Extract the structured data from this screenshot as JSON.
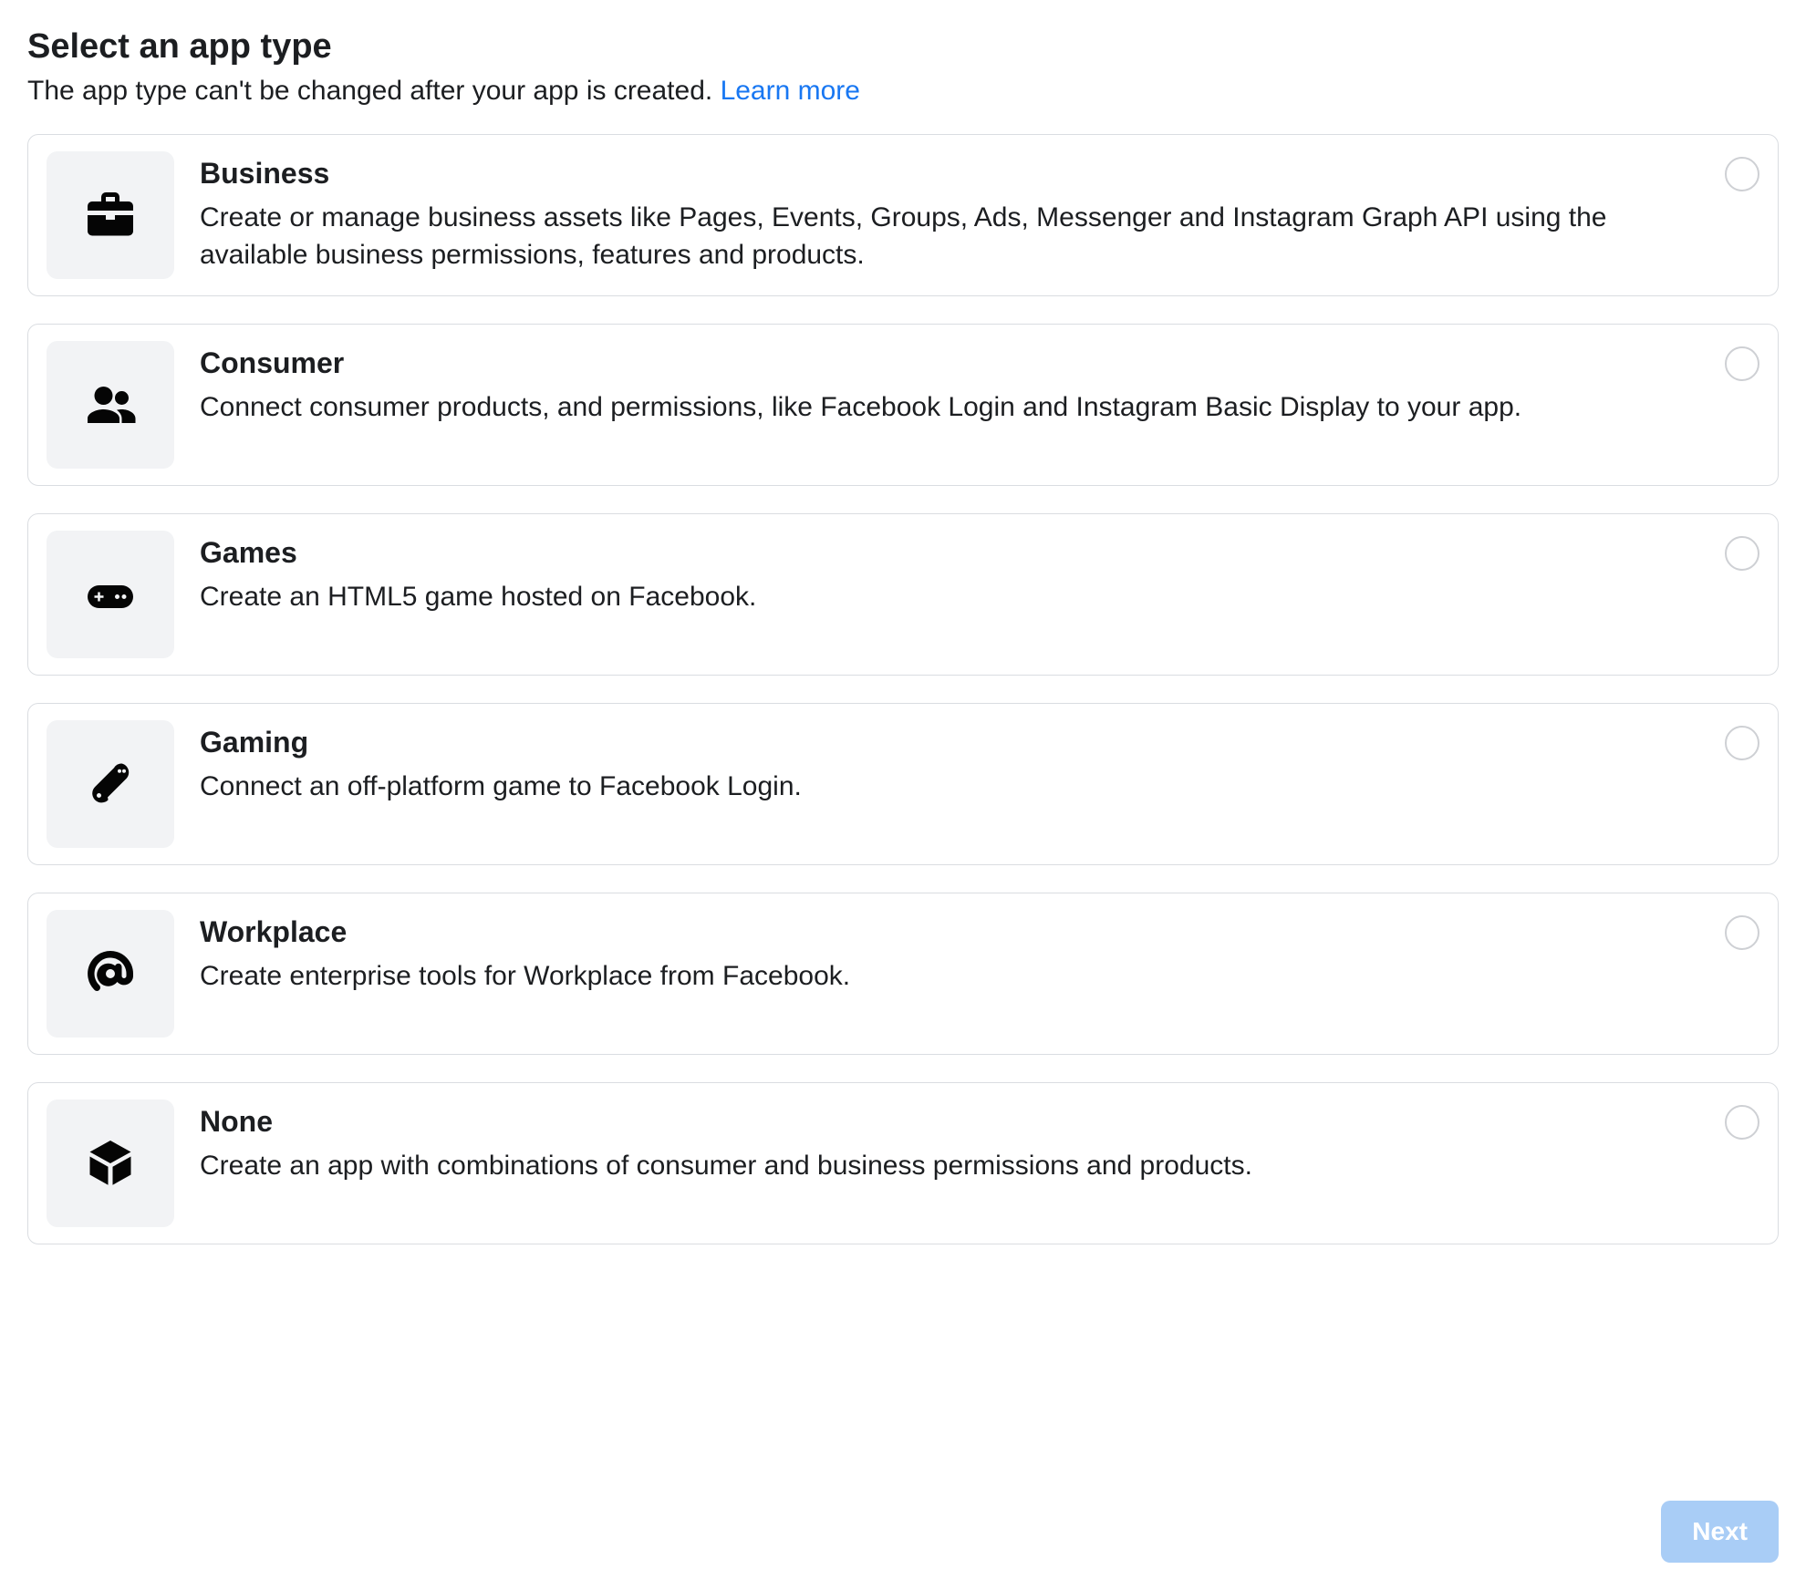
{
  "header": {
    "title": "Select an app type",
    "subtitle_prefix": "The app type can't be changed after your app is created. ",
    "learn_more": "Learn more"
  },
  "options": [
    {
      "icon": "briefcase-icon",
      "title": "Business",
      "description": "Create or manage business assets like Pages, Events, Groups, Ads, Messenger and Instagram Graph API using the available business permissions, features and products."
    },
    {
      "icon": "people-icon",
      "title": "Consumer",
      "description": "Connect consumer products, and permissions, like Facebook Login and Instagram Basic Display to your app."
    },
    {
      "icon": "gamepad-icon",
      "title": "Games",
      "description": "Create an HTML5 game hosted on Facebook."
    },
    {
      "icon": "joystick-icon",
      "title": "Gaming",
      "description": "Connect an off-platform game to Facebook Login."
    },
    {
      "icon": "workplace-icon",
      "title": "Workplace",
      "description": "Create enterprise tools for Workplace from Facebook."
    },
    {
      "icon": "cube-icon",
      "title": "None",
      "description": "Create an app with combinations of consumer and business permissions and products."
    }
  ],
  "footer": {
    "next_label": "Next"
  }
}
